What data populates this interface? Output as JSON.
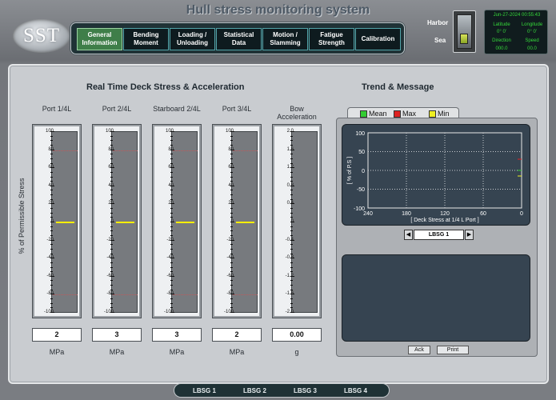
{
  "app": {
    "title": "Hull stress monitoring system",
    "logo_text": "SST"
  },
  "nav": [
    {
      "label": "General Information",
      "active": true
    },
    {
      "label": "Bending Moment",
      "active": false
    },
    {
      "label": "Loading / Unloading",
      "active": false
    },
    {
      "label": "Statistical Data",
      "active": false
    },
    {
      "label": "Motion / Slamming",
      "active": false
    },
    {
      "label": "Fatigue Strength",
      "active": false
    },
    {
      "label": "Calibration",
      "active": false
    }
  ],
  "mode_switch": {
    "top_label": "Harbor",
    "bottom_label": "Sea",
    "selected": "Sea"
  },
  "info_panel": {
    "datetime": "Jun-27-2024  00:55:43",
    "latitude_label": "Latitude",
    "latitude_value": "0° 0'",
    "longitude_label": "Longitude",
    "longitude_value": "0° 0'",
    "direction_label": "Direction",
    "direction_value": "000.0",
    "speed_label": "Speed",
    "speed_value": "00.0"
  },
  "realtime": {
    "title": "Real Time Deck Stress & Acceleration",
    "ylabel": "% of Permissible Stress",
    "gauges": [
      {
        "label": "Port 1/4L",
        "value": "2",
        "unit": "MPa",
        "level": 0,
        "ticks": [
          "100",
          "80",
          "60",
          "40",
          "20",
          "0",
          "-20",
          "-40",
          "-60",
          "-80",
          "-100"
        ],
        "limit_lines": [
          80,
          -80
        ],
        "range": [
          -100,
          100
        ]
      },
      {
        "label": "Port 2/4L",
        "value": "3",
        "unit": "MPa",
        "level": 0,
        "ticks": [
          "100",
          "80",
          "60",
          "40",
          "20",
          "0",
          "-20",
          "-40",
          "-60",
          "-80",
          "-100"
        ],
        "limit_lines": [
          80,
          -80
        ],
        "range": [
          -100,
          100
        ]
      },
      {
        "label": "Starboard 2/4L",
        "value": "3",
        "unit": "MPa",
        "level": 0,
        "ticks": [
          "100",
          "80",
          "60",
          "40",
          "20",
          "0",
          "-20",
          "-40",
          "-60",
          "-80",
          "-100"
        ],
        "limit_lines": [
          80,
          -80
        ],
        "range": [
          -100,
          100
        ]
      },
      {
        "label": "Port 3/4L",
        "value": "2",
        "unit": "MPa",
        "level": 0,
        "ticks": [
          "100",
          "80",
          "60",
          "40",
          "20",
          "0",
          "-20",
          "-40",
          "-60",
          "-80",
          "-100"
        ],
        "limit_lines": [
          80,
          -80
        ],
        "range": [
          -100,
          100
        ]
      },
      {
        "label": "Bow Acceleration",
        "value": "0.00",
        "unit": "g",
        "level": null,
        "ticks": [
          "2.0",
          "1.6",
          "1.2",
          "0.8",
          "0.4",
          "0",
          "-0.4",
          "-0.8",
          "-1.2",
          "-1.6",
          "-2.0"
        ],
        "limit_lines": [],
        "range": [
          -2,
          2
        ]
      }
    ]
  },
  "trend": {
    "title": "Trend & Message",
    "legend": [
      {
        "label": "Mean",
        "color": "#33cc33"
      },
      {
        "label": "Max",
        "color": "#dd2222"
      },
      {
        "label": "Min",
        "color": "#eeee22"
      }
    ],
    "chart": {
      "ylabel": "[ % of P.S ]",
      "xlabel": "[ Deck Stress at 1/4 L Port ]",
      "xticks": [
        "240",
        "180",
        "120",
        "60",
        "0"
      ],
      "yticks": [
        "100",
        "50",
        "0",
        "-50",
        "-100"
      ]
    },
    "selector": "LBSG 1",
    "prev_icon": "◀",
    "next_icon": "▶",
    "ack_label": "Ack",
    "print_label": "Print"
  },
  "bottom_tabs": [
    "LBSG 1",
    "LBSG 2",
    "LBSG 3",
    "LBSG 4"
  ],
  "colors": {
    "nav_active": "#3f7e49",
    "level_marker": "#ffee00",
    "limit_line": "#c0595b"
  }
}
